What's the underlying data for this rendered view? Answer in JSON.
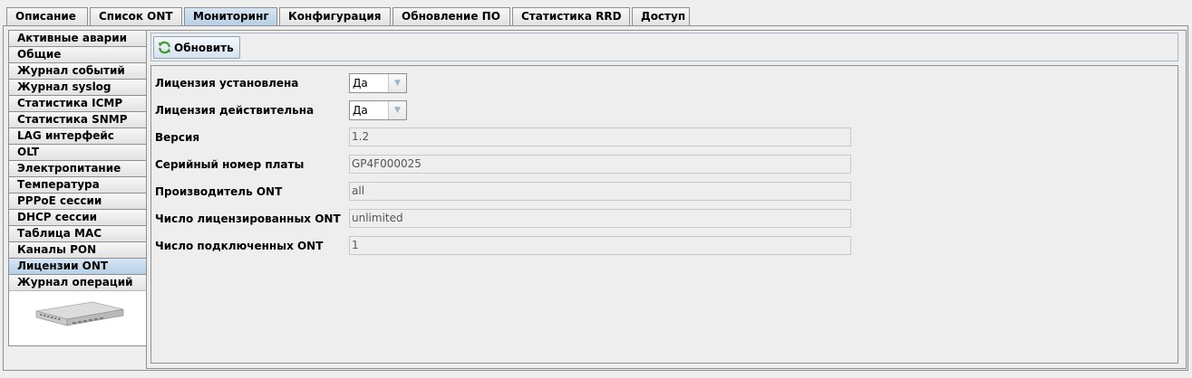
{
  "top_tabs": [
    "Описание",
    "Список ONT",
    "Мониторинг",
    "Конфигурация",
    "Обновление ПО",
    "Статистика RRD",
    "Доступ"
  ],
  "top_tab_active": "Мониторинг",
  "side_tabs": [
    "Активные аварии",
    "Общие",
    "Журнал событий",
    "Журнал syslog",
    "Статистика ICMP",
    "Статистика SNMP",
    "LAG интерфейс",
    "OLT",
    "Электропитание",
    "Температура",
    "PPPoE сессии",
    "DHCP сессии",
    "Таблица MAC",
    "Каналы PON",
    "Лицензии ONT",
    "Журнал операций"
  ],
  "side_tab_active": "Лицензии ONT",
  "toolbar": {
    "refresh_label": "Обновить",
    "refresh_icon": "refresh-icon"
  },
  "form": {
    "license_installed": {
      "label": "Лицензия установлена",
      "value": "Да"
    },
    "license_valid": {
      "label": "Лицензия действительна",
      "value": "Да"
    },
    "version": {
      "label": "Версия",
      "value": "1.2"
    },
    "board_serial": {
      "label": "Серийный номер платы",
      "value": "GP4F000025"
    },
    "ont_vendor": {
      "label": "Производитель ONT",
      "value": "all"
    },
    "licensed_ont_count": {
      "label": "Число лицензированных ONT",
      "value": "unlimited"
    },
    "connected_ont_count": {
      "label": "Число подключенных ONT",
      "value": "1"
    }
  },
  "colors": {
    "active_tab": "#c4d8ec",
    "background": "#eeeeee",
    "border": "#8e8f8f"
  }
}
